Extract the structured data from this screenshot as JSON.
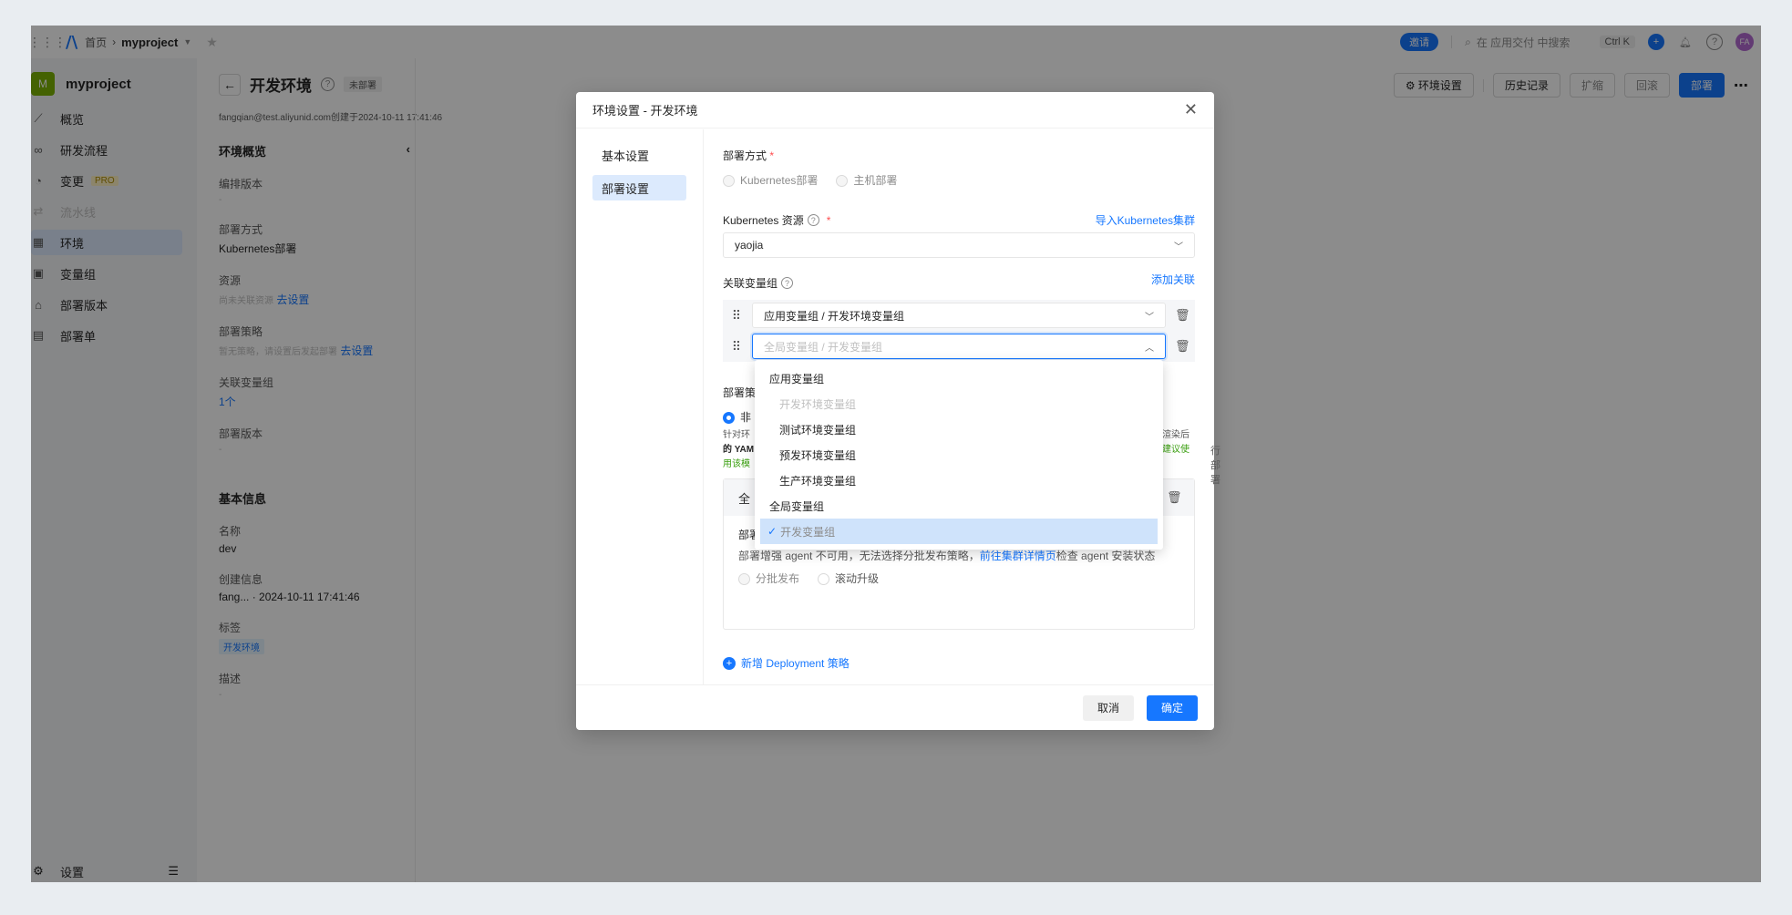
{
  "topbar": {
    "breadcrumb_home": "首页",
    "breadcrumb_project": "myproject",
    "invite": "邀请",
    "search_placeholder": "在 应用交付 中搜索",
    "shortcut": "Ctrl K",
    "avatar_initials": "FA"
  },
  "sidebar": {
    "project_initial": "M",
    "project_name": "myproject",
    "items": [
      {
        "label": "概览"
      },
      {
        "label": "研发流程"
      },
      {
        "label": "变更",
        "badge": "PRO"
      },
      {
        "label": "流水线"
      },
      {
        "label": "环境"
      },
      {
        "label": "变量组"
      },
      {
        "label": "部署版本"
      },
      {
        "label": "部署单"
      }
    ],
    "settings": "设置"
  },
  "header": {
    "title": "开发环境",
    "status_tag": "未部署",
    "sub_info": "fangqian@test.aliyunid.com创建于2024-10-11 17:41:46",
    "actions": [
      "环境设置",
      "历史记录",
      "扩缩",
      "回滚",
      "部署"
    ]
  },
  "detail": {
    "overview_title": "环境概览",
    "orchestration_label": "编排版本",
    "orchestration_value": "-",
    "deploy_method_label": "部署方式",
    "deploy_method_value": "Kubernetes部署",
    "resource_label": "资源",
    "resource_hint": "尚未关联资源",
    "resource_link": "去设置",
    "strategy_label": "部署策略",
    "strategy_hint": "暂无策略，请设置后发起部署",
    "strategy_link": "去设置",
    "vargroup_label": "关联变量组",
    "vargroup_value": "1个",
    "deploy_version_label": "部署版本",
    "deploy_version_value": "-",
    "basic_title": "基本信息",
    "name_label": "名称",
    "name_value": "dev",
    "created_label": "创建信息",
    "created_value": "fang... · 2024-10-11 17:41:46",
    "tags_label": "标签",
    "tag_value": "开发环境",
    "desc_label": "描述",
    "desc_value": "-"
  },
  "modal": {
    "title": "环境设置 - 开发环境",
    "nav": [
      "基本设置",
      "部署设置"
    ],
    "deploy_mode_label": "部署方式",
    "deploy_mode_options": [
      "Kubernetes部署",
      "主机部署"
    ],
    "k8s_label": "Kubernetes 资源",
    "k8s_import": "导入Kubernetes集群",
    "k8s_value": "yaojia",
    "vargroup_label": "关联变量组",
    "vargroup_add": "添加关联",
    "vargroup_row1": "应用变量组 / 开发环境变量组",
    "vargroup_row2_placeholder": "全局变量组 / 开发变量组",
    "strategy_partial_label": "部署策",
    "strategy_partial_option": "非",
    "strategy_line1_start": "针对环",
    "strategy_line1_end": "渲染后",
    "strategy_line2_start": "的 YAM",
    "strategy_line2_end": "建议使",
    "strategy_line3_start": "用该模",
    "strategy_side": "行部署",
    "card_title_partial": "全",
    "card_strategy_label": "部署策略",
    "card_warning_pre": "部署增强 agent 不可用，无法选择分批发布策略，",
    "card_warning_link": "前往集群详情页",
    "card_warning_post": "检查 agent 安装状态",
    "card_options": [
      "分批发布",
      "滚动升级"
    ],
    "add_deployment": "新增 Deployment 策略",
    "cancel": "取消",
    "confirm": "确定"
  },
  "dropdown": {
    "groups": [
      {
        "label": "应用变量组",
        "options": [
          {
            "label": "开发环境变量组",
            "state": "disabled"
          },
          {
            "label": "测试环境变量组",
            "state": "normal"
          },
          {
            "label": "预发环境变量组",
            "state": "normal"
          },
          {
            "label": "生产环境变量组",
            "state": "normal"
          }
        ]
      },
      {
        "label": "全局变量组",
        "options": [
          {
            "label": "开发变量组",
            "state": "selected"
          }
        ]
      }
    ]
  },
  "colors": {
    "primary": "#1677ff",
    "active_bg": "#dceafd",
    "mask": "rgba(0,0,0,0.45)"
  }
}
